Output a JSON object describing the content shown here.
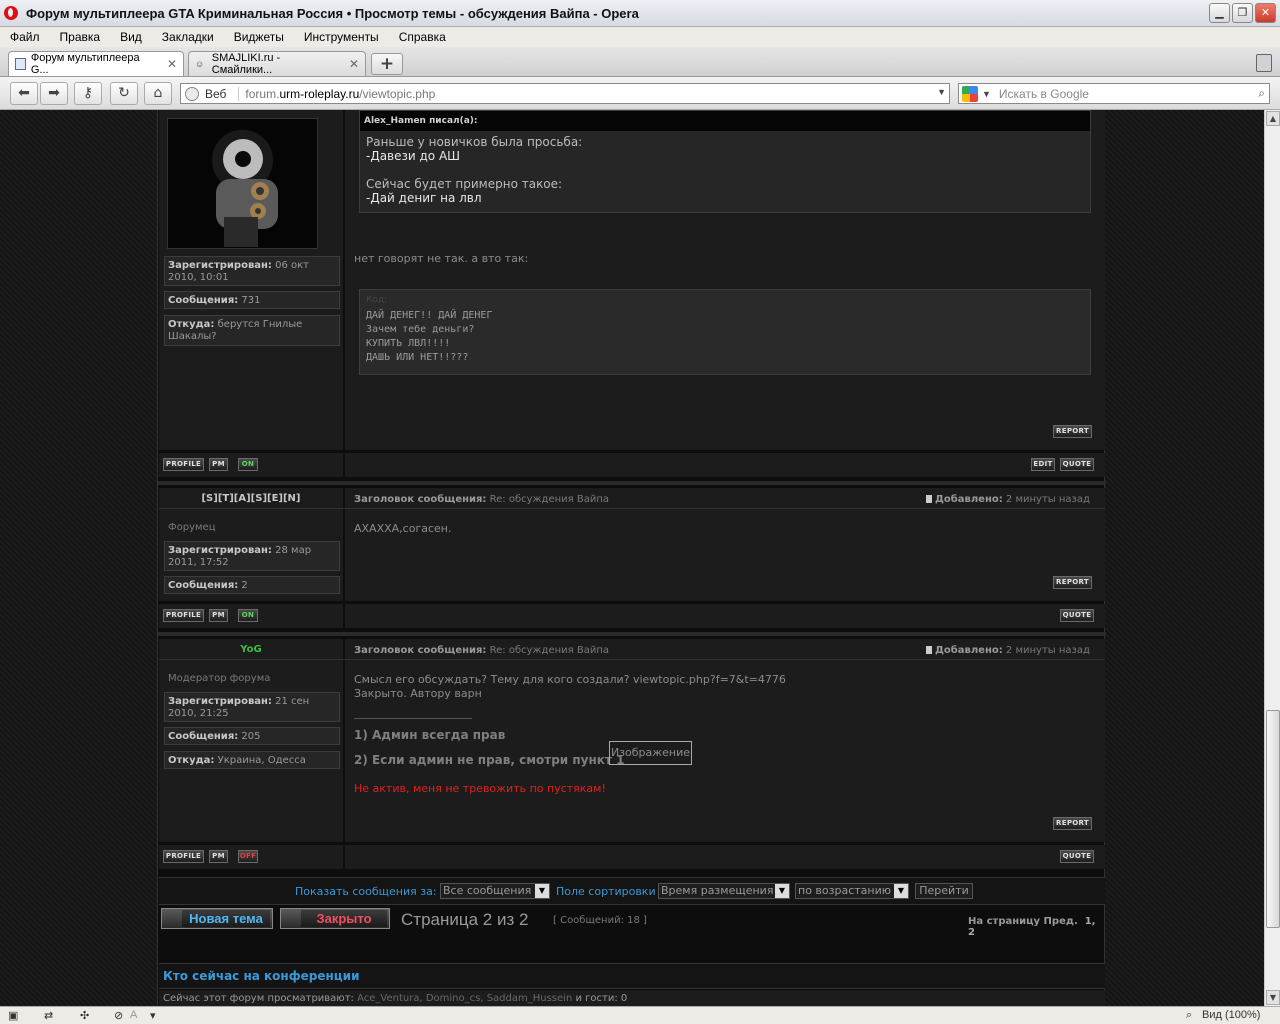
{
  "window": {
    "title": "Форум мультиплеера GTA Криминальная Россия • Просмотр темы - обсуждения Вайпа - Opera",
    "minimize": "▁",
    "maximize": "❐",
    "close": "✕"
  },
  "menu": [
    "Файл",
    "Правка",
    "Вид",
    "Закладки",
    "Виджеты",
    "Инструменты",
    "Справка"
  ],
  "tabs": [
    {
      "label": "Форум мультиплеера G...",
      "active": true
    },
    {
      "label": "SMAJLIKI.ru - Смайлики...",
      "active": false
    }
  ],
  "newtab": "+",
  "addressbar": {
    "web_label": "Веб",
    "url_prefix": "forum.",
    "url_host": "urm-roleplay.ru",
    "url_path": "/viewtopic.php",
    "search_placeholder": "Искать в Google"
  },
  "post1": {
    "registered_label": "Зарегистрирован:",
    "registered_value": "06 окт 2010, 10:01",
    "messages_label": "Сообщения:",
    "messages_value": "731",
    "from_label": "Откуда:",
    "from_value": "берутся Гнилые Шакалы?",
    "quote_author": "Alex_Hamen писал(а):",
    "quote_lines": [
      "Раньше у новичков была просьба:",
      "-Давези до АШ",
      "",
      "Сейчас будет примерно такое:",
      "-Дай дениг на лвл"
    ],
    "text": "нет говорят не так. а вто так:",
    "code_label": "Код:",
    "code": "ДАЙ ДЕНЕГ!! ДАЙ ДЕНЕГ\nЗачем тебе деньги?\nКУПИТЬ ЛВЛ!!!!\nДАШЬ ИЛИ НЕТ!!???",
    "online": "ON"
  },
  "post2": {
    "username": "[S][T][A][S][E][N]",
    "rank": "Форумец",
    "registered_label": "Зарегистрирован:",
    "registered_value": "28 мар 2011, 17:52",
    "messages_label": "Сообщения:",
    "messages_value": "2",
    "subject_label": "Заголовок сообщения:",
    "subject_value": "Re: обсуждения Вайпа",
    "added_label": "Добавлено:",
    "added_value": "2 минуты назад",
    "text": "АХАХХА,согасен.",
    "online": "ON"
  },
  "post3": {
    "username": "YoG",
    "rank": "Модератор форума",
    "registered_label": "Зарегистрирован:",
    "registered_value": "21 сен 2010, 21:25",
    "messages_label": "Сообщения:",
    "messages_value": "205",
    "from_label": "Откуда:",
    "from_value": "Украина, Одесса",
    "subject_label": "Заголовок сообщения:",
    "subject_value": "Re: обсуждения Вайпа",
    "added_label": "Добавлено:",
    "added_value": "2 минуты назад",
    "text_line1": "Смысл его обсуждать? Тему для кого создали? viewtopic.php?f=7&t=4776",
    "text_line2": "Закрыто. Автору варн",
    "sig_line1": "1) Админ всегда прав",
    "sig_line2": "2) Если админ не прав, смотри пункт 1",
    "sig_image": "Изображение",
    "sig_red": "Не актив, меня не тревожить по пустякам!",
    "online": "OFF"
  },
  "buttons": {
    "profile": "PROFILE",
    "pm": "PM",
    "report": "REPORT",
    "edit": "EDIT",
    "quote": "QUOTE"
  },
  "sortbar": {
    "show_label": "Показать сообщения за:",
    "show_value": "Все сообщения",
    "sort_label": "Поле сортировки",
    "sort_value": "Время размещения",
    "order_value": "по возрастанию",
    "go": "Перейти"
  },
  "pagination": {
    "new_topic": "Новая тема",
    "closed": "Закрыто",
    "page_text": "Страница 2 из 2",
    "posts_count": "[ Сообщений: 18 ]",
    "goto_label": "На страницу Пред.",
    "pages": "1, 2"
  },
  "online_block": {
    "title": "Кто сейчас на конференции",
    "text_prefix": "Сейчас этот форум просматривают:",
    "users": "Ace_Ventura, Domino_cs, Saddam_Hussein",
    "text_suffix": "и гости: 0"
  },
  "statusbar": {
    "zoom": "Вид (100%)"
  },
  "colors": {
    "page_bg": "#161616",
    "panel_bg": "#1c1c1c",
    "moderator_name": "#3fbf3f",
    "link_blue": "#3a9ad9",
    "warning_red": "#e02020"
  }
}
